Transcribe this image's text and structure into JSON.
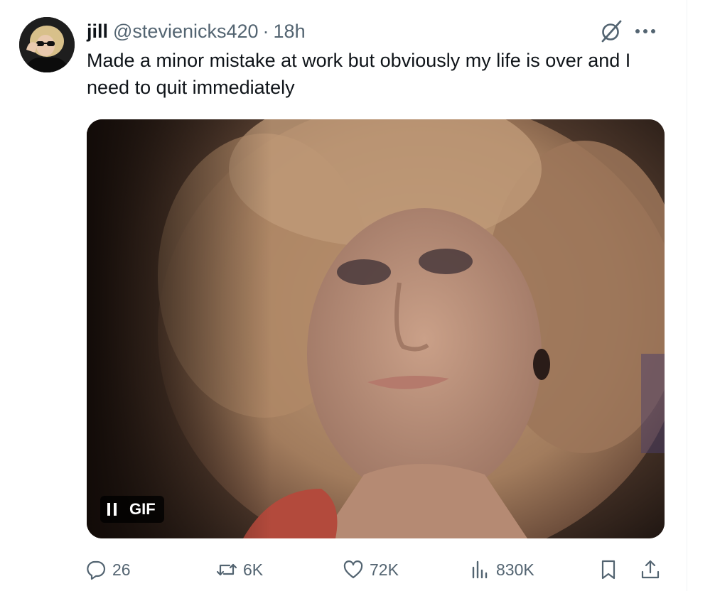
{
  "author": {
    "display_name": "jill",
    "handle": "@stevienicks420",
    "separator": "·",
    "time": "18h"
  },
  "tweet": {
    "text": "Made a minor mistake at work but obviously my life is over and I need to quit immediately"
  },
  "media": {
    "type": "gif",
    "badge_label": "GIF",
    "state": "playing"
  },
  "actions": {
    "replies": "26",
    "reposts": "6K",
    "likes": "72K",
    "views": "830K"
  },
  "icons": {
    "header": [
      "grok-icon",
      "more-icon"
    ],
    "actions": [
      "reply-icon",
      "repost-icon",
      "like-icon",
      "views-icon",
      "bookmark-icon",
      "share-icon"
    ]
  },
  "colors": {
    "text_primary": "#0f1419",
    "text_secondary": "#536471",
    "background": "#ffffff",
    "badge_background": "#000000"
  }
}
